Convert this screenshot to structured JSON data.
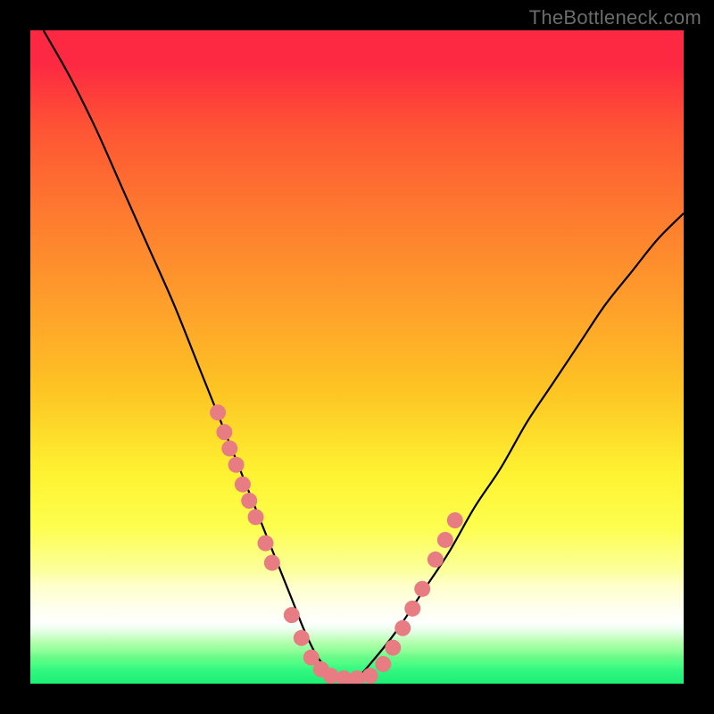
{
  "watermark": "TheBottleneck.com",
  "chart_data": {
    "type": "line",
    "title": "",
    "xlabel": "",
    "ylabel": "",
    "xlim": [
      0,
      100
    ],
    "ylim": [
      0,
      100
    ],
    "curve": {
      "x": [
        2,
        6,
        10,
        14,
        18,
        22,
        26,
        30,
        32,
        34,
        36,
        38,
        40,
        42,
        44,
        46,
        48,
        50,
        52,
        56,
        60,
        64,
        68,
        72,
        76,
        80,
        84,
        88,
        92,
        96,
        100
      ],
      "y": [
        100,
        93,
        85,
        76,
        67,
        58,
        48,
        38,
        33,
        28,
        23,
        18,
        13,
        8,
        4,
        2,
        1,
        1,
        3,
        8,
        14,
        20,
        27,
        33,
        40,
        46,
        52,
        58,
        63,
        68,
        72
      ]
    },
    "markers": {
      "x": [
        28.7,
        29.7,
        30.5,
        31.5,
        32.5,
        33.5,
        34.5,
        36.0,
        37.0,
        40.0,
        41.5,
        43.0,
        44.5,
        46.0,
        48.0,
        50.0,
        52.0,
        54.0,
        55.5,
        57.0,
        58.5,
        60.0,
        62.0,
        63.5,
        65.0
      ],
      "y": [
        41.5,
        38.5,
        36.0,
        33.5,
        30.5,
        28.0,
        25.5,
        21.5,
        18.5,
        10.5,
        7.0,
        4.0,
        2.2,
        1.2,
        0.8,
        0.8,
        1.2,
        3.0,
        5.5,
        8.5,
        11.5,
        14.5,
        19.0,
        22.0,
        25.0
      ],
      "color": "#e77d82",
      "radius": 9
    },
    "line_color": "#000000",
    "line_width": 2.2,
    "gradient_stops": [
      {
        "pos": 0.0,
        "color": "#fd2842"
      },
      {
        "pos": 0.28,
        "color": "#fe7a2f"
      },
      {
        "pos": 0.55,
        "color": "#fdc423"
      },
      {
        "pos": 0.76,
        "color": "#fdfe4e"
      },
      {
        "pos": 0.9,
        "color": "#ffffff"
      },
      {
        "pos": 1.0,
        "color": "#1df075"
      }
    ]
  }
}
